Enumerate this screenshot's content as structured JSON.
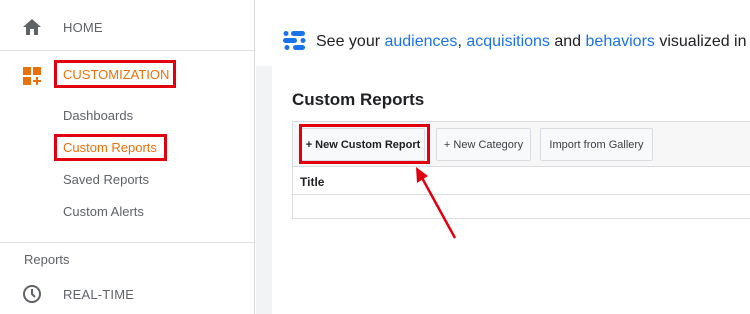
{
  "sidebar": {
    "home_label": "HOME",
    "customization_label": "CUSTOMIZATION",
    "sub_items": [
      "Dashboards",
      "Custom Reports",
      "Saved Reports",
      "Custom Alerts"
    ],
    "reports_section": "Reports",
    "realtime_label": "REAL-TIME"
  },
  "banner": {
    "prefix": "See your ",
    "link1": "audiences",
    "sep1": ", ",
    "link2": "acquisitions",
    "sep2": " and ",
    "link3": "behaviors",
    "suffix": " visualized in a"
  },
  "main": {
    "title": "Custom Reports",
    "buttons": {
      "new_report": "+ New Custom Report",
      "new_category": "+ New Category",
      "import": "Import from Gallery"
    },
    "table": {
      "column_title": "Title"
    }
  },
  "colors": {
    "accent_orange": "#e8710a",
    "link_blue": "#1a73e8",
    "highlight_red": "#e0000f"
  },
  "icons": [
    "home-icon",
    "customization-icon",
    "clock-icon",
    "insights-icon"
  ]
}
